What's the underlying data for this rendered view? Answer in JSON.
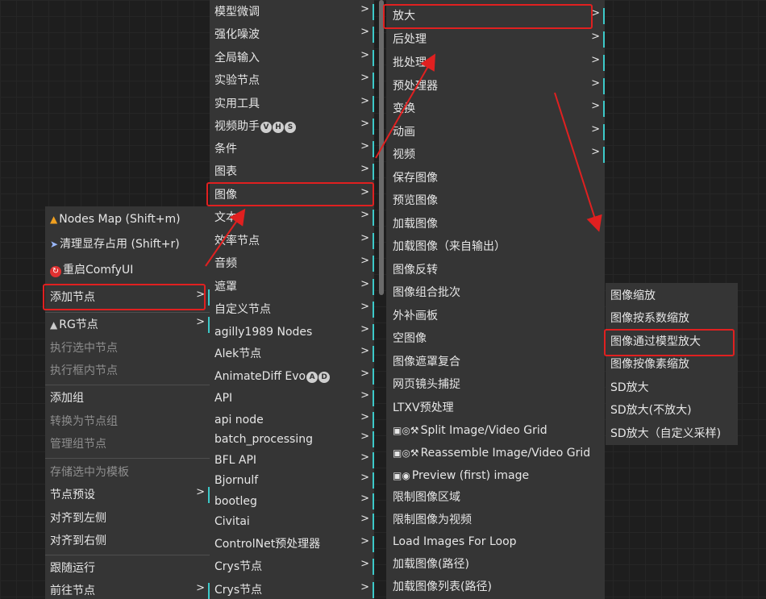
{
  "menu1": {
    "items": [
      {
        "label": "Nodes Map (Shift+m)",
        "icon": "sitemap-icon",
        "state": "normal"
      },
      {
        "label": "清理显存占用 (Shift+r)",
        "icon": "rocket-icon",
        "state": "normal"
      },
      {
        "label": "重启ComfyUI",
        "icon": "restart-icon",
        "state": "normal"
      },
      {
        "label": "添加节点",
        "state": "highlighted",
        "submenu": true
      },
      {
        "label": "RG节点",
        "icon": "mountain-icon",
        "state": "normal",
        "submenu": true
      },
      {
        "label": "执行选中节点",
        "state": "disabled"
      },
      {
        "label": "执行框内节点",
        "state": "disabled"
      },
      {
        "label": "添加组",
        "state": "normal"
      },
      {
        "label": "转换为节点组",
        "state": "disabled"
      },
      {
        "label": "管理组节点",
        "state": "disabled"
      },
      {
        "label": "存储选中为模板",
        "state": "disabled"
      },
      {
        "label": "节点预设",
        "state": "normal",
        "submenu": true
      },
      {
        "label": "对齐到左侧",
        "state": "normal"
      },
      {
        "label": "对齐到右侧",
        "state": "normal"
      },
      {
        "label": "跟随运行",
        "state": "normal"
      },
      {
        "label": "前往节点",
        "state": "normal",
        "submenu": true
      }
    ]
  },
  "menu2": {
    "items": [
      {
        "label": "模型微调"
      },
      {
        "label": "强化噪波"
      },
      {
        "label": "全局输入"
      },
      {
        "label": "实验节点"
      },
      {
        "label": "实用工具"
      },
      {
        "label": "视频助手",
        "badges": [
          "V",
          "H",
          "S"
        ]
      },
      {
        "label": "条件"
      },
      {
        "label": "图表"
      },
      {
        "label": "图像",
        "state": "highlighted"
      },
      {
        "label": "文本"
      },
      {
        "label": "效率节点"
      },
      {
        "label": "音频"
      },
      {
        "label": "遮罩"
      },
      {
        "label": "自定义节点"
      },
      {
        "label": "agilly1989 Nodes"
      },
      {
        "label": "Alek节点"
      },
      {
        "label": "AnimateDiff Evo",
        "badges": [
          "A",
          "D"
        ]
      },
      {
        "label": "API"
      },
      {
        "label": "api node"
      },
      {
        "label": "batch_processing"
      },
      {
        "label": "BFL API"
      },
      {
        "label": "Bjornulf"
      },
      {
        "label": "bootleg"
      },
      {
        "label": "Civitai"
      },
      {
        "label": "ControlNet预处理器"
      },
      {
        "label": "Crys节点"
      },
      {
        "label": "Crys节点"
      }
    ]
  },
  "menu3": {
    "items": [
      {
        "label": "放大",
        "submenu": true,
        "state": "highlighted"
      },
      {
        "label": "后处理",
        "submenu": true
      },
      {
        "label": "批处理",
        "submenu": true
      },
      {
        "label": "预处理器",
        "submenu": true
      },
      {
        "label": "变换",
        "submenu": true
      },
      {
        "label": "动画",
        "submenu": true
      },
      {
        "label": "视频",
        "submenu": true
      },
      {
        "label": "保存图像"
      },
      {
        "label": "预览图像"
      },
      {
        "label": "加载图像"
      },
      {
        "label": "加载图像（来自输出）"
      },
      {
        "label": "图像反转"
      },
      {
        "label": "图像组合批次"
      },
      {
        "label": "外补画板"
      },
      {
        "label": "空图像"
      },
      {
        "label": "图像遮罩复合"
      },
      {
        "label": "网页镜头捕捉"
      },
      {
        "label": "LTXV预处理"
      },
      {
        "label": "Split Image/Video Grid",
        "icon": "video-grid-icon"
      },
      {
        "label": "Reassemble Image/Video Grid",
        "icon": "video-grid-icon"
      },
      {
        "label": "Preview (first) image",
        "icon": "eye-icon"
      },
      {
        "label": "限制图像区域"
      },
      {
        "label": "限制图像为视频"
      },
      {
        "label": "Load Images For Loop"
      },
      {
        "label": "加载图像(路径)"
      },
      {
        "label": "加载图像列表(路径)"
      }
    ]
  },
  "menu4": {
    "items": [
      {
        "label": "图像缩放"
      },
      {
        "label": "图像按系数缩放"
      },
      {
        "label": "图像通过模型放大",
        "state": "highlighted"
      },
      {
        "label": "图像按像素缩放"
      },
      {
        "label": "SD放大"
      },
      {
        "label": "SD放大(不放大)"
      },
      {
        "label": "SD放大（自定义采样)"
      }
    ]
  },
  "colors": {
    "menu_bg": "#353535",
    "accent": "#3cc9c9",
    "highlight_border": "#e02020",
    "arrow": "#e02020"
  }
}
